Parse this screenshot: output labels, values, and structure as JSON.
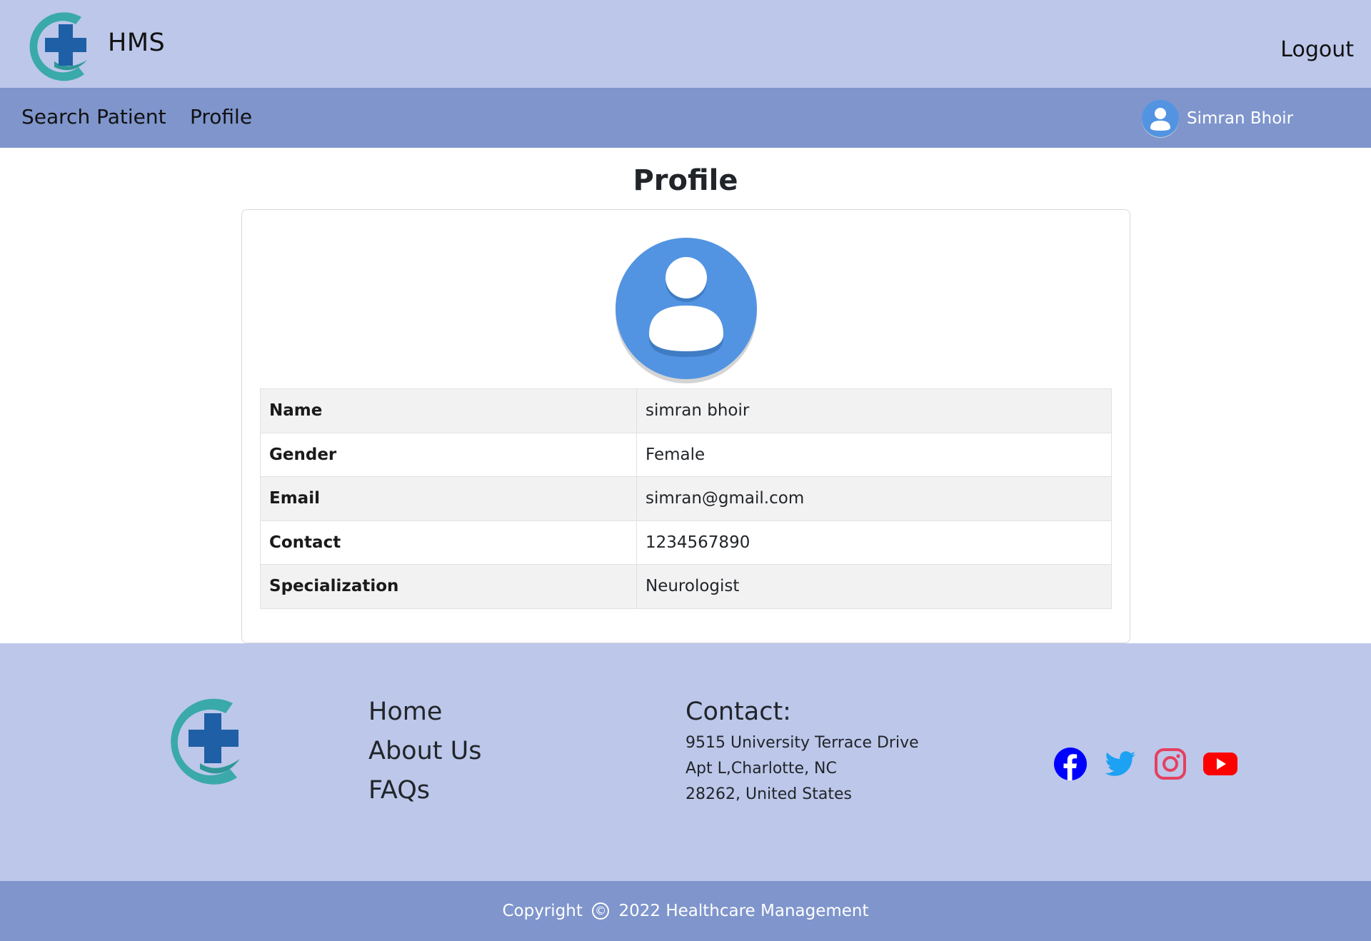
{
  "header": {
    "brand": "HMS",
    "logout_label": "Logout"
  },
  "nav": {
    "items": [
      {
        "label": "Search Patient"
      },
      {
        "label": "Profile"
      }
    ],
    "user_name": "Simran Bhoir"
  },
  "main": {
    "title": "Profile",
    "profile": [
      {
        "key": "Name",
        "value": "simran bhoir"
      },
      {
        "key": "Gender",
        "value": "Female"
      },
      {
        "key": "Email",
        "value": "simran@gmail.com"
      },
      {
        "key": "Contact",
        "value": "1234567890"
      },
      {
        "key": "Specialization",
        "value": "Neurologist"
      }
    ]
  },
  "footer": {
    "links": [
      {
        "label": "Home"
      },
      {
        "label": "About Us"
      },
      {
        "label": "FAQs"
      }
    ],
    "contact_title": "Contact:",
    "address": [
      "9515 University Terrace Drive",
      "Apt L,Charlotte, NC",
      "28262, United States"
    ],
    "socials": [
      "facebook-icon",
      "twitter-icon",
      "instagram-icon",
      "youtube-icon"
    ],
    "copyright_prefix": "Copyright",
    "copyright_symbol": "©",
    "copyright_text": "2022 Healthcare Management"
  },
  "colors": {
    "header_bg": "#bcc7ea",
    "nav_bg": "#7f95cc",
    "avatar_blue": "#5294e2",
    "logo_teal": "#3aa9a9",
    "logo_blue": "#1f5fa6",
    "facebook": "#0000ff",
    "twitter": "#1da1f2",
    "instagram": "#e4405f",
    "youtube": "#ff0000"
  }
}
